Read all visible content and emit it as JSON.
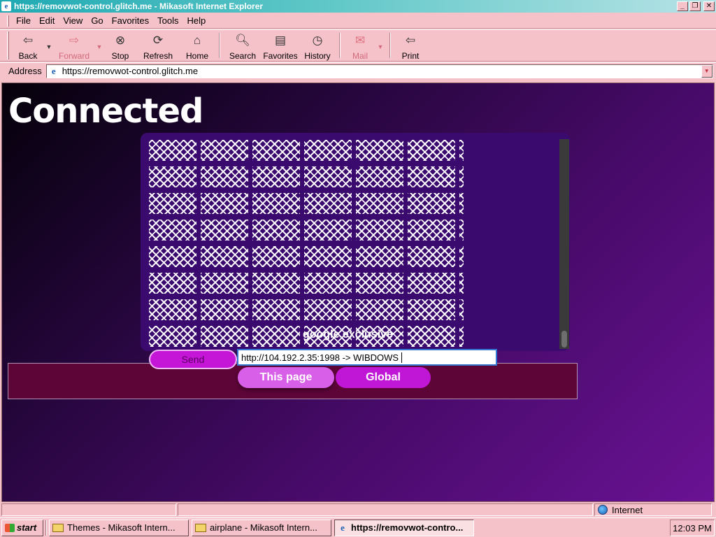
{
  "window": {
    "title": "https://removwot-control.glitch.me - Mikasoft Internet Explorer"
  },
  "menu": [
    {
      "label": "File"
    },
    {
      "label": "Edit"
    },
    {
      "label": "View"
    },
    {
      "label": "Go"
    },
    {
      "label": "Favorites"
    },
    {
      "label": "Tools"
    },
    {
      "label": "Help"
    }
  ],
  "toolbar": {
    "back": "Back",
    "forward": "Forward",
    "stop": "Stop",
    "refresh": "Refresh",
    "home": "Home",
    "search": "Search",
    "favorites": "Favorites",
    "history": "History",
    "mail": "Mail",
    "print": "Print"
  },
  "address": {
    "label": "Address",
    "url": "https://removwot-control.glitch.me"
  },
  "page": {
    "title": "Connected",
    "caption": "google exclusive",
    "send_label": "Send",
    "input_value": "http://104.192.2.35:1998 -> WIBDOWS",
    "tab_this": "This page",
    "tab_global": "Global"
  },
  "status": {
    "zone": "Internet"
  },
  "taskbar": {
    "start": "start",
    "tasks": [
      {
        "label": "Themes - Mikasoft Intern..."
      },
      {
        "label": "airplane - Mikasoft Intern..."
      },
      {
        "label": "https://removwot-contro..."
      }
    ],
    "clock": "12:03 PM"
  },
  "colors": {
    "chrome": "#f4c2c8",
    "accent": "#c016d6",
    "panel": "#3b0a6f"
  }
}
